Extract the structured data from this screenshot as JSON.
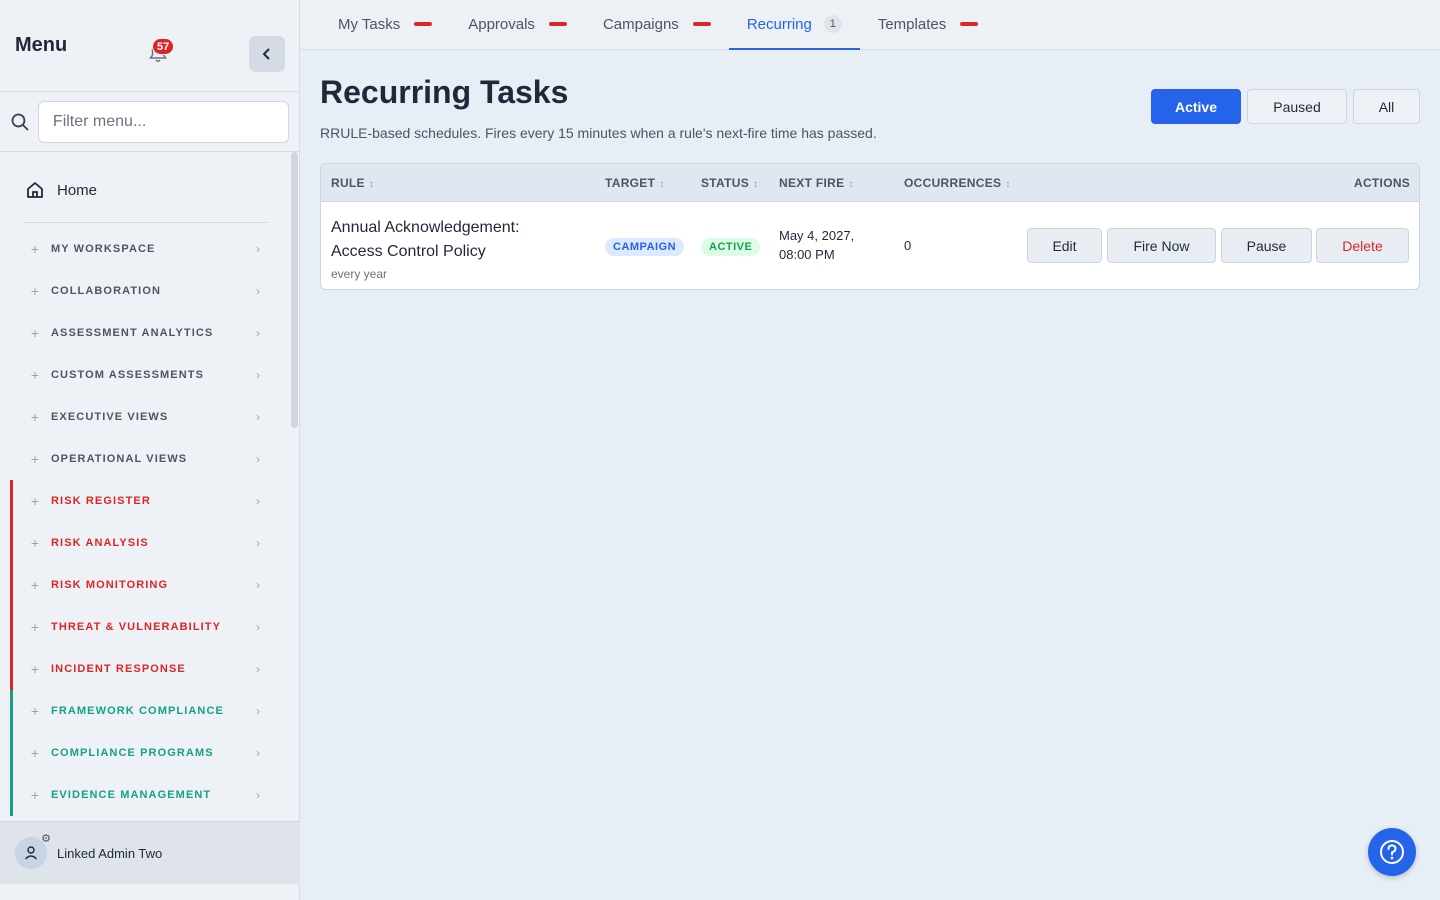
{
  "sidebar": {
    "title": "Menu",
    "notification_count": "57",
    "filter_placeholder": "Filter menu...",
    "home_label": "Home",
    "items": [
      {
        "label": "MY WORKSPACE",
        "tone": "default"
      },
      {
        "label": "COLLABORATION",
        "tone": "default"
      },
      {
        "label": "ASSESSMENT ANALYTICS",
        "tone": "default"
      },
      {
        "label": "CUSTOM ASSESSMENTS",
        "tone": "default"
      },
      {
        "label": "EXECUTIVE VIEWS",
        "tone": "default"
      },
      {
        "label": "OPERATIONAL VIEWS",
        "tone": "default"
      },
      {
        "label": "RISK REGISTER",
        "tone": "red"
      },
      {
        "label": "RISK ANALYSIS",
        "tone": "red"
      },
      {
        "label": "RISK MONITORING",
        "tone": "red"
      },
      {
        "label": "THREAT & VULNERABILITY",
        "tone": "red"
      },
      {
        "label": "INCIDENT RESPONSE",
        "tone": "red"
      },
      {
        "label": "FRAMEWORK COMPLIANCE",
        "tone": "green"
      },
      {
        "label": "COMPLIANCE PROGRAMS",
        "tone": "green"
      },
      {
        "label": "EVIDENCE MANAGEMENT",
        "tone": "green"
      }
    ],
    "user_name": "Linked Admin Two"
  },
  "tabs": [
    {
      "label": "My Tasks",
      "indicator": "dash"
    },
    {
      "label": "Approvals",
      "indicator": "dash"
    },
    {
      "label": "Campaigns",
      "indicator": "dash"
    },
    {
      "label": "Recurring",
      "indicator": "count",
      "count": "1",
      "active": true
    },
    {
      "label": "Templates",
      "indicator": "dash"
    }
  ],
  "page": {
    "title": "Recurring Tasks",
    "subtitle": "RRULE-based schedules. Fires every 15 minutes when a rule's next-fire time has passed.",
    "filters": {
      "active": "Active",
      "paused": "Paused",
      "all": "All"
    }
  },
  "table": {
    "headers": {
      "rule": "RULE",
      "target": "TARGET",
      "status": "STATUS",
      "next_fire": "NEXT FIRE",
      "occurrences": "OCCURRENCES",
      "actions": "ACTIONS"
    },
    "rows": [
      {
        "rule_title": "Annual Acknowledgement: Access Control Policy",
        "rule_frequency": "every year",
        "target": "CAMPAIGN",
        "status": "ACTIVE",
        "next_fire": "May 4, 2027, 08:00 PM",
        "occurrences": "0",
        "actions": {
          "edit": "Edit",
          "fire_now": "Fire Now",
          "pause": "Pause",
          "delete": "Delete"
        }
      }
    ]
  },
  "colors": {
    "accent": "#2563eb",
    "danger": "#dc2626",
    "success": "#16a34a",
    "compliance": "#16a085"
  }
}
